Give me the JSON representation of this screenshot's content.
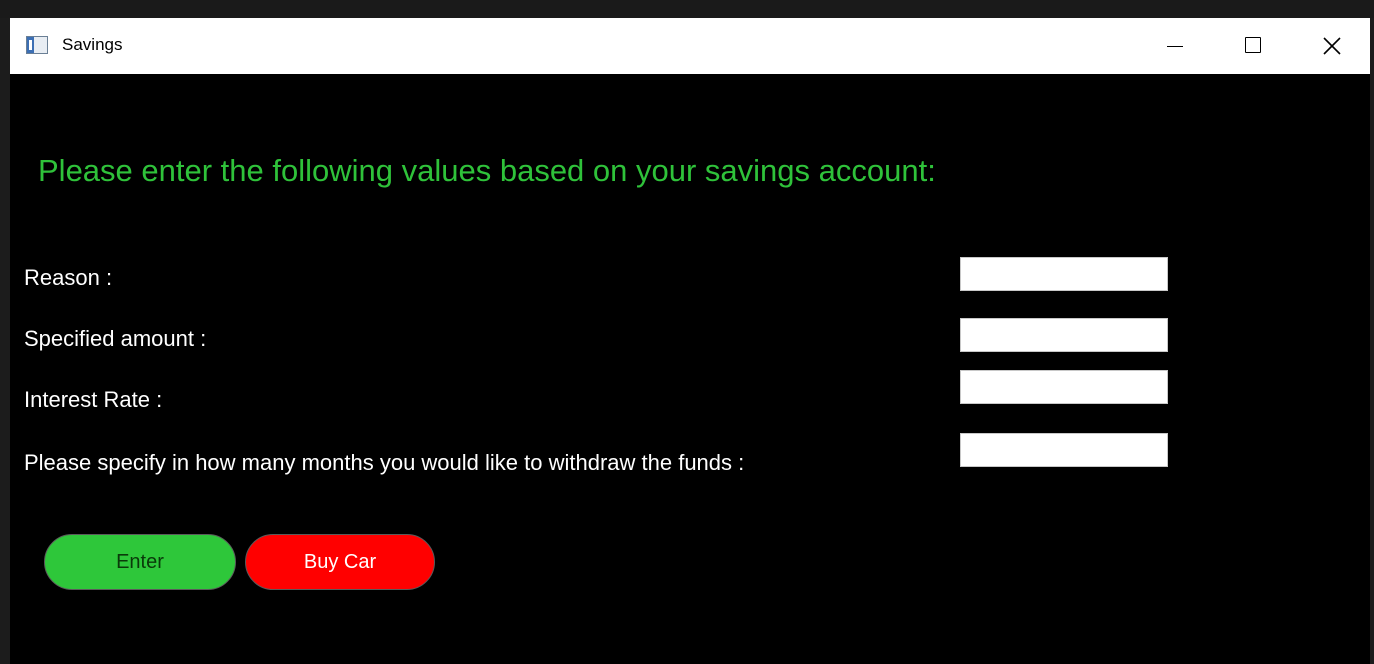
{
  "window": {
    "title": "Savings",
    "controls": {
      "minimize": "minimize-icon",
      "maximize": "maximize-icon",
      "close": "close-icon"
    }
  },
  "form": {
    "heading": "Please enter the following values based on your savings account:",
    "fields": [
      {
        "label": "Reason :",
        "value": ""
      },
      {
        "label": "Specified amount :",
        "value": ""
      },
      {
        "label": "Interest Rate :",
        "value": ""
      },
      {
        "label": "Please specify in how many months you would like to withdraw the funds :",
        "value": ""
      }
    ]
  },
  "buttons": {
    "enter": "Enter",
    "buy_car": "Buy Car"
  },
  "colors": {
    "heading": "#2fc23a",
    "background": "#000000",
    "enter_button": "#2ec73a",
    "buy_car_button": "#ff0000",
    "label_text": "#ffffff"
  }
}
